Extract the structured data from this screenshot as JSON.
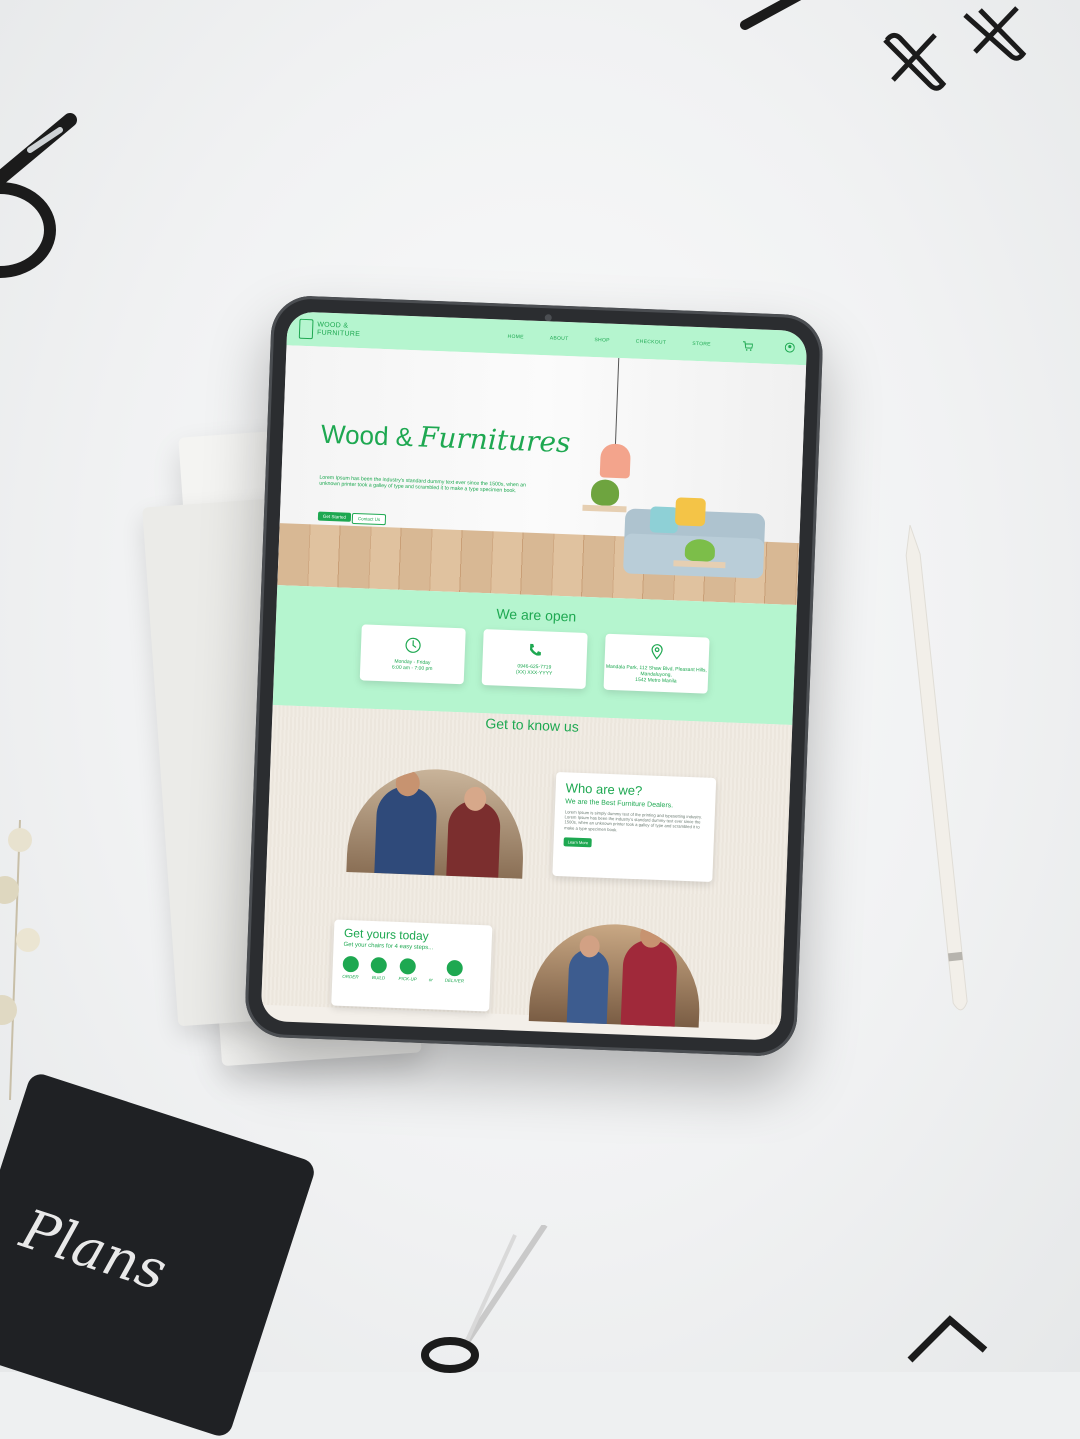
{
  "site": {
    "logo_text": "WOOD & FURNITURE",
    "nav": [
      "HOME",
      "ABOUT",
      "SHOP",
      "CHECKOUT",
      "STORE"
    ],
    "icons": {
      "cart": "cart-icon",
      "account": "user-icon"
    }
  },
  "hero": {
    "title_plain": "Wood &",
    "title_script": "Furnitures",
    "text": "Lorem Ipsum has been the industry's standard dummy text ever since the 1500s, when an unknown printer took a galley of type and scrambled it to make a type specimen book.",
    "primary_button": "Get Started",
    "secondary_button": "Contact Us"
  },
  "open": {
    "title": "We are open",
    "cards": [
      {
        "icon": "clock-icon",
        "line1": "Monday - Friday",
        "line2": "6:00 am - 7:00 pm"
      },
      {
        "icon": "phone-icon",
        "line1": "0946-625-7719",
        "line2": "(XX) XXX-YYYY"
      },
      {
        "icon": "location-pin-icon",
        "line1": "Mandala Park, 112 Shaw Blvd, Pleasant Hills, Mandaluyong,",
        "line2": "1542 Metro Manila"
      }
    ]
  },
  "know": {
    "title": "Get to know us",
    "who_title": "Who are we?",
    "who_subtitle": "We are the Best Furniture Dealers.",
    "who_text": "Lorem Ipsum is simply dummy text of the printing and typesetting industry. Lorem Ipsum has been the industry's standard dummy text ever since the 1500s, when an unknown printer took a galley of type and scrambled it to make a type specimen book.",
    "who_button": "Learn More"
  },
  "get": {
    "title": "Get yours today",
    "subtitle": "Get your chairs for 4 easy steps...",
    "steps": [
      "ORDER",
      "BUILD",
      "PICK-UP",
      "or",
      "DELIVER"
    ]
  },
  "colors": {
    "accent": "#1ea851",
    "mint": "#b5f5cf"
  }
}
